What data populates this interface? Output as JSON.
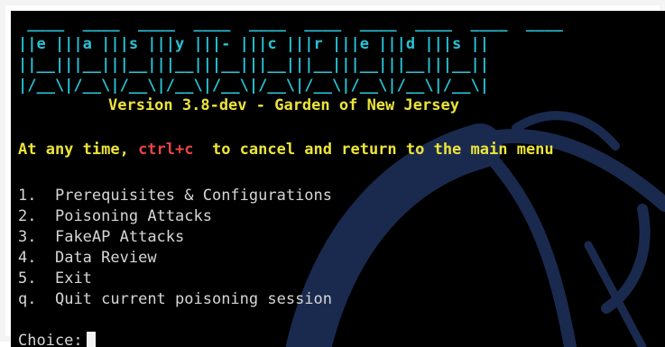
{
  "banner": {
    "row_top": " ____  ____  ____  ____  ____  ____  ____  ____  ____  ____",
    "row_letters": "||e |||a |||s |||y |||- |||c |||r |||e |||d |||s ||",
    "row_under": "||__|||__|||__|||__|||__|||__|||__|||__|||__|||__||",
    "row_bottom": "|/__\\|/__\\|/__\\|/__\\|/__\\|/__\\|/__\\|/__\\|/__\\|/__\\|"
  },
  "version_text": "Version 3.8-dev - Garden of New Jersey",
  "notice": {
    "prefix": "At any time, ",
    "key": "ctrl+c",
    "suffix": "  to cancel and return to the main menu"
  },
  "menu": {
    "items": [
      {
        "key": "1.",
        "label": "Prerequisites & Configurations"
      },
      {
        "key": "2.",
        "label": "Poisoning Attacks"
      },
      {
        "key": "3.",
        "label": "FakeAP Attacks"
      },
      {
        "key": "4.",
        "label": "Data Review"
      },
      {
        "key": "5.",
        "label": "Exit"
      },
      {
        "key": "q.",
        "label": "Quit current poisoning session"
      }
    ]
  },
  "prompt": {
    "label": "Choice:",
    "value": ""
  },
  "colors": {
    "background": "#000000",
    "banner": "#27c3d6",
    "version": "#ece43a",
    "notice_key": "#e64545",
    "text": "#d6d6d6",
    "watermark": "#1a2a4e"
  },
  "icons": {
    "watermark": "kali-dragon-icon",
    "cursor": "block-cursor-icon"
  }
}
